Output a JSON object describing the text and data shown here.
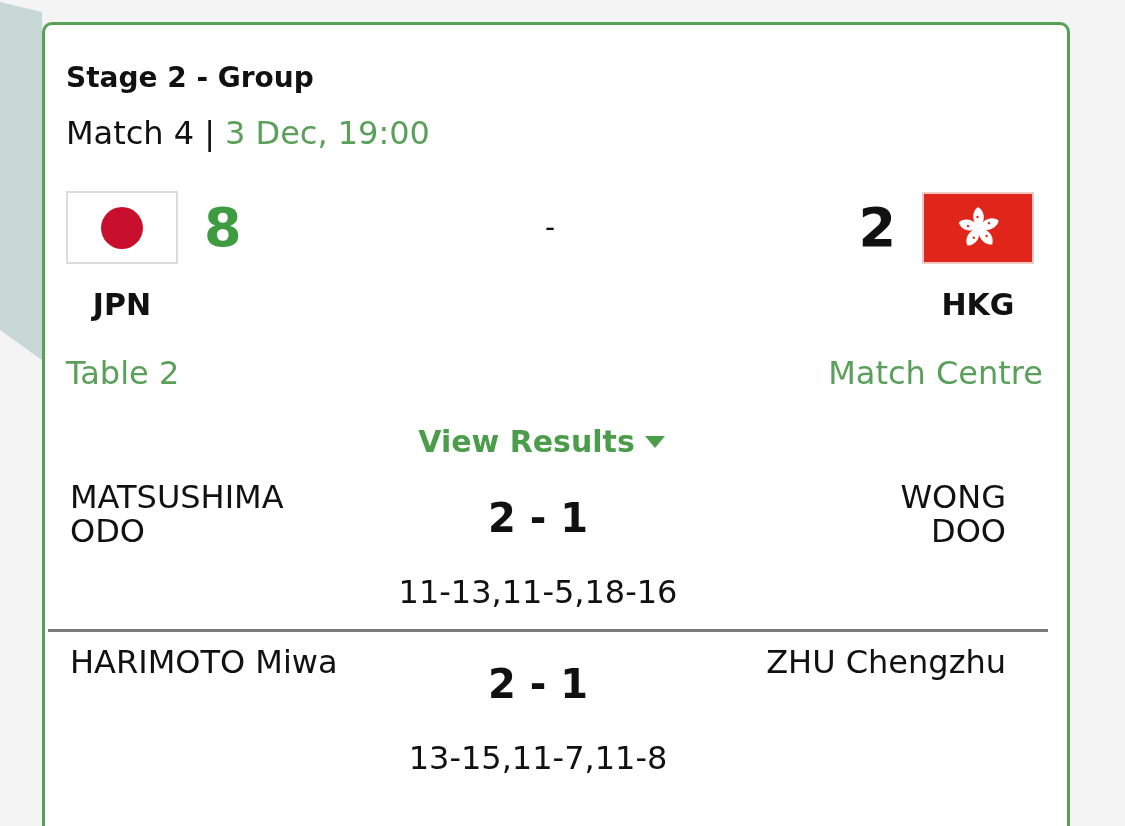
{
  "header": {
    "stage": "Stage 2 - Group",
    "match": "Match 4",
    "separator": "|",
    "datetime": "3 Dec, 19:00"
  },
  "teams": [
    {
      "kind": "japan",
      "code": "JPN",
      "score": "8",
      "winner": true
    },
    {
      "kind": "hongkong",
      "code": "HKG",
      "score": "2",
      "winner": false
    }
  ],
  "score_separator": "-",
  "links": {
    "table": "Table 2",
    "match_centre": "Match Centre"
  },
  "results_toggle": {
    "label": "View Results",
    "expanded": true
  },
  "results": [
    {
      "left_players": [
        "MATSUSHIMA",
        "ODO"
      ],
      "score": "2 - 1",
      "right_players": [
        "WONG",
        "DOO"
      ],
      "games": "11-13,11-5,18-16"
    },
    {
      "left_players": [
        "HARIMOTO Miwa"
      ],
      "score": "2 - 1",
      "right_players": [
        "ZHU Chengzhu"
      ],
      "games": "13-15,11-7,11-8"
    }
  ]
}
